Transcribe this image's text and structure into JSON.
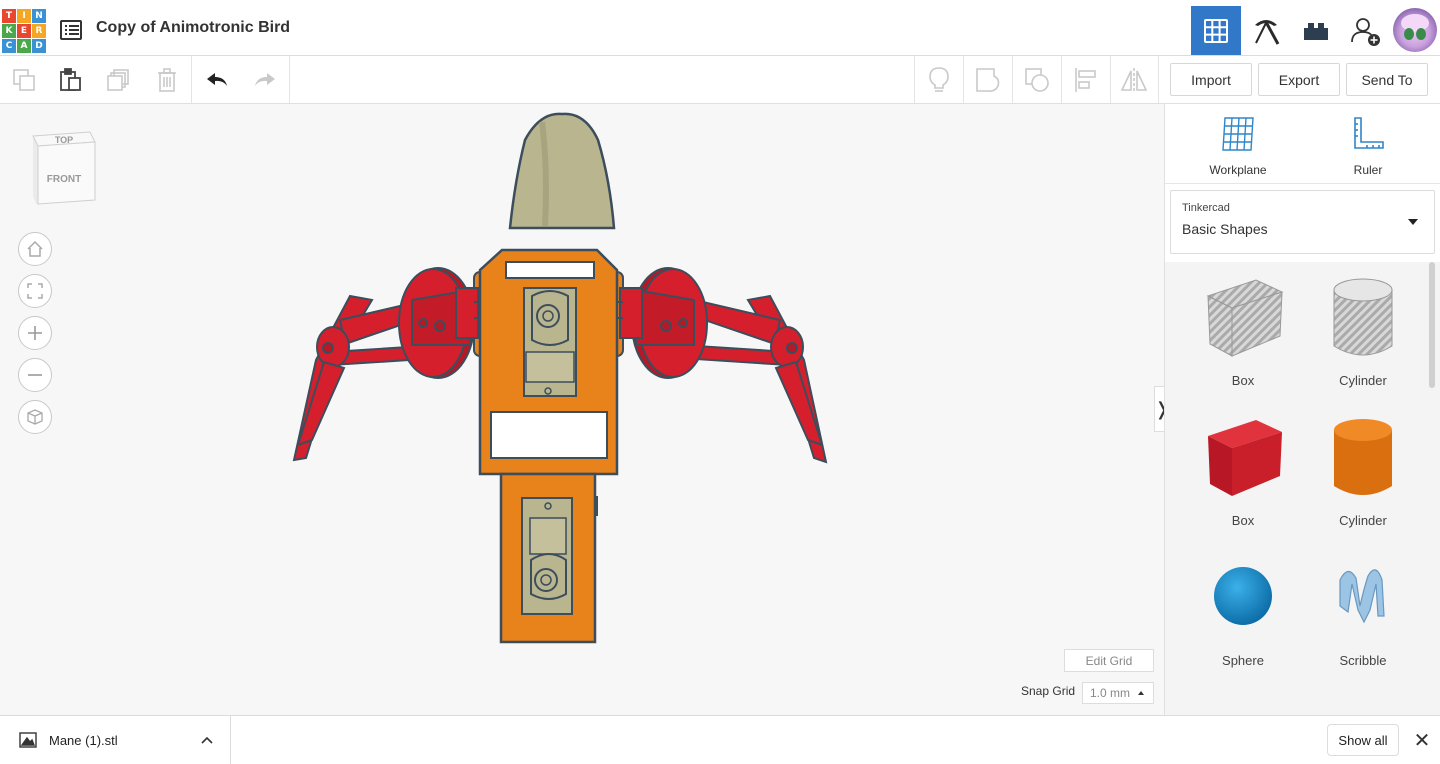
{
  "app": {
    "logo_letters": [
      "T",
      "I",
      "N",
      "K",
      "E",
      "R",
      "C",
      "A",
      "D"
    ],
    "logo_colors": [
      "#e8462e",
      "#f5a623",
      "#3a92d4",
      "#4aa84a",
      "#e8462e",
      "#f5a623",
      "#3a92d4",
      "#4aa84a",
      "#3a92d4"
    ],
    "title": "Copy of Animotronic Bird"
  },
  "header": {
    "buttons": [
      {
        "icon": "3d-view-grid-icon",
        "active": true
      },
      {
        "icon": "pickaxe-icon",
        "active": false
      },
      {
        "icon": "bricks-icon",
        "active": false
      },
      {
        "icon": "add-user-icon",
        "active": false
      }
    ],
    "accent_color": "#3278c8"
  },
  "toolbar": {
    "tools": [
      "copy-icon",
      "paste-icon",
      "duplicate-icon",
      "delete-icon",
      "undo-icon",
      "redo-icon"
    ],
    "right_tools": [
      "light-bulb-icon",
      "group-icon",
      "ungroup-icon",
      "align-icon",
      "mirror-icon"
    ],
    "import_label": "Import",
    "export_label": "Export",
    "send_to_label": "Send To"
  },
  "workspace": {
    "viewcube": {
      "top_label": "TOP",
      "front_label": "FRONT"
    },
    "nav": [
      "home-view-icon",
      "fit-view-icon",
      "zoom-in-icon",
      "zoom-out-icon",
      "perspective-icon"
    ],
    "edit_grid_label": "Edit Grid",
    "snap_grid_label": "Snap Grid",
    "snap_grid_value": "1.0 mm",
    "collapse_glyph": "❭"
  },
  "panel": {
    "workplane_label": "Workplane",
    "ruler_label": "Ruler",
    "library_category": "Tinkercad",
    "library_name": "Basic Shapes",
    "shapes": [
      {
        "name": "Box",
        "style": "hole"
      },
      {
        "name": "Cylinder",
        "style": "hole"
      },
      {
        "name": "Box",
        "color": "#c8202a"
      },
      {
        "name": "Cylinder",
        "color": "#e57a14"
      },
      {
        "name": "Sphere",
        "color": "#1a8fcf"
      },
      {
        "name": "Scribble",
        "color": "#9cc4e4"
      }
    ]
  },
  "download_bar": {
    "file_name": "Mane (1).stl",
    "show_all_label": "Show all",
    "close_glyph": "✕"
  }
}
